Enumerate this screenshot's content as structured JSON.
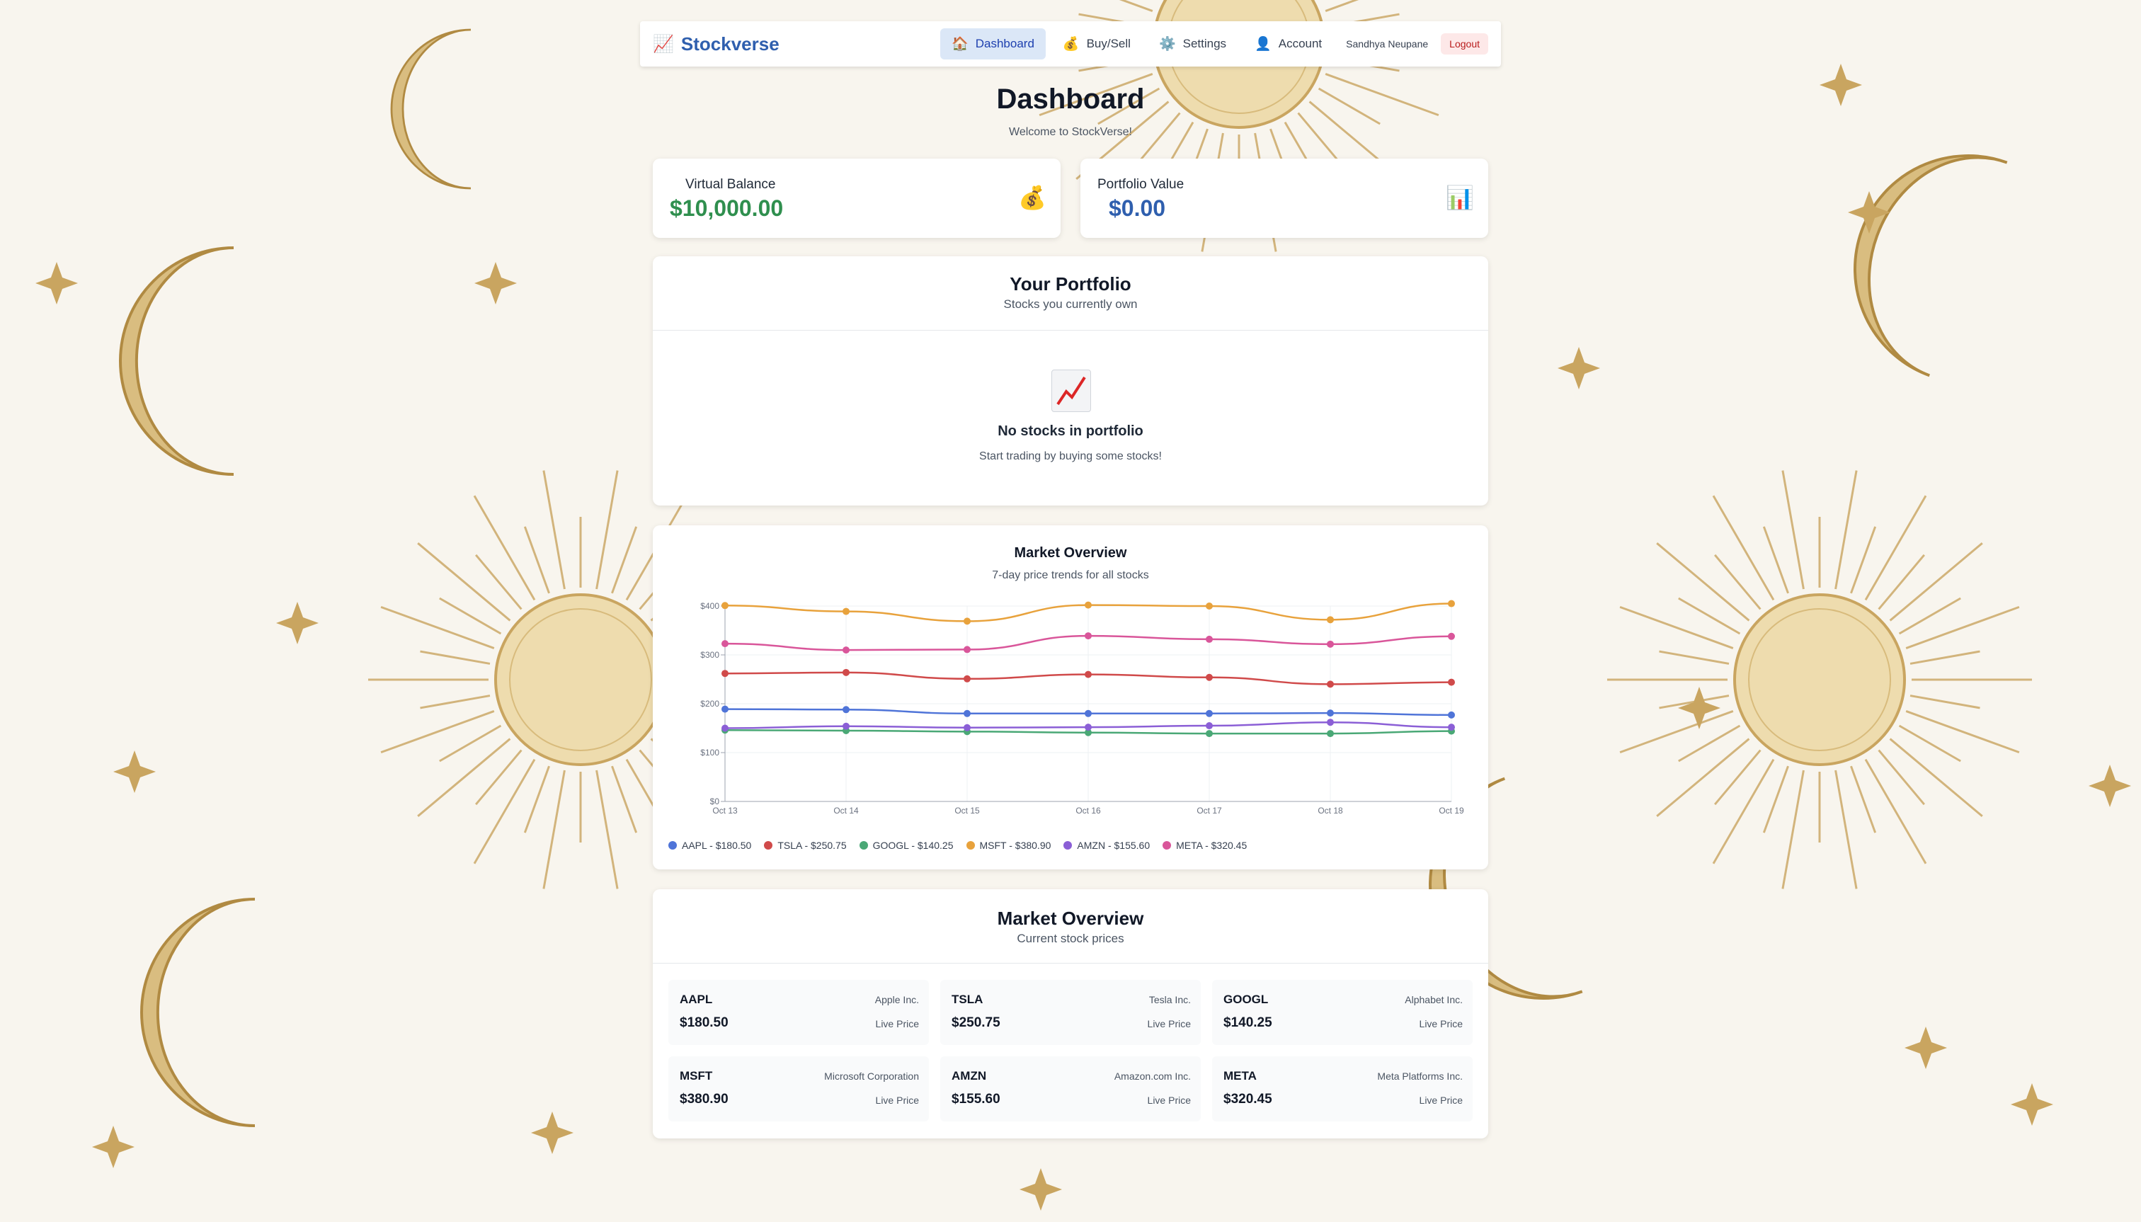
{
  "nav": {
    "brand_icon": "chart-up-icon",
    "brand": "Stockverse",
    "links": [
      {
        "label": "Dashboard",
        "icon": "house-icon",
        "glyph": "🏠",
        "active": true
      },
      {
        "label": "Buy/Sell",
        "icon": "money-bag-icon",
        "glyph": "💰",
        "active": false
      },
      {
        "label": "Settings",
        "icon": "gear-icon",
        "glyph": "⚙️",
        "active": false
      },
      {
        "label": "Account",
        "icon": "user-icon",
        "glyph": "👤",
        "active": false
      }
    ],
    "user_name": "Sandhya Neupane",
    "logout_label": "Logout"
  },
  "header": {
    "title": "Dashboard",
    "subtitle": "Welcome to StockVerse!"
  },
  "stats": {
    "balance": {
      "label": "Virtual Balance",
      "value": "$10,000.00",
      "icon": "money-bag-icon",
      "color": "#2f8f4e"
    },
    "portfolio": {
      "label": "Portfolio Value",
      "value": "$0.00",
      "icon": "bar-chart-icon",
      "color": "#2f5fae"
    }
  },
  "portfolio": {
    "title": "Your Portfolio",
    "subtitle": "Stocks you currently own",
    "empty_icon": "chart-up-icon",
    "empty_title": "No stocks in portfolio",
    "empty_subtitle": "Start trading by buying some stocks!"
  },
  "chart_section": {
    "title": "Market Overview",
    "subtitle": "7-day price trends for all stocks"
  },
  "chart_data": {
    "type": "line",
    "x": [
      "Oct 13",
      "Oct 14",
      "Oct 15",
      "Oct 16",
      "Oct 17",
      "Oct 18",
      "Oct 19"
    ],
    "ylim": [
      0,
      400
    ],
    "yticks": [
      "$0",
      "$100",
      "$200",
      "$300",
      "$400"
    ],
    "series": [
      {
        "name": "AAPL - $180.50",
        "color": "#4f74d8",
        "values": [
          189,
          188,
          180,
          180,
          180,
          181,
          177
        ]
      },
      {
        "name": "TSLA - $250.75",
        "color": "#d04a4a",
        "values": [
          262,
          264,
          251,
          260,
          254,
          240,
          244
        ]
      },
      {
        "name": "GOOGL - $140.25",
        "color": "#4aa876",
        "values": [
          146,
          145,
          143,
          141,
          139,
          139,
          144
        ]
      },
      {
        "name": "MSFT - $380.90",
        "color": "#e8a23c",
        "values": [
          401,
          389,
          369,
          402,
          400,
          372,
          405
        ]
      },
      {
        "name": "AMZN - $155.60",
        "color": "#8b5fd6",
        "values": [
          150,
          154,
          151,
          152,
          155,
          162,
          152
        ]
      },
      {
        "name": "META - $320.45",
        "color": "#d9569a",
        "values": [
          323,
          310,
          311,
          339,
          332,
          322,
          338
        ]
      }
    ]
  },
  "market": {
    "title": "Market Overview",
    "subtitle": "Current stock prices",
    "stocks": [
      {
        "symbol": "AAPL",
        "name": "Apple Inc.",
        "price": "$180.50",
        "tag": "Live Price"
      },
      {
        "symbol": "TSLA",
        "name": "Tesla Inc.",
        "price": "$250.75",
        "tag": "Live Price"
      },
      {
        "symbol": "GOOGL",
        "name": "Alphabet Inc.",
        "price": "$140.25",
        "tag": "Live Price"
      },
      {
        "symbol": "MSFT",
        "name": "Microsoft Corporation",
        "price": "$380.90",
        "tag": "Live Price"
      },
      {
        "symbol": "AMZN",
        "name": "Amazon.com Inc.",
        "price": "$155.60",
        "tag": "Live Price"
      },
      {
        "symbol": "META",
        "name": "Meta Platforms Inc.",
        "price": "$320.45",
        "tag": "Live Price"
      }
    ]
  }
}
